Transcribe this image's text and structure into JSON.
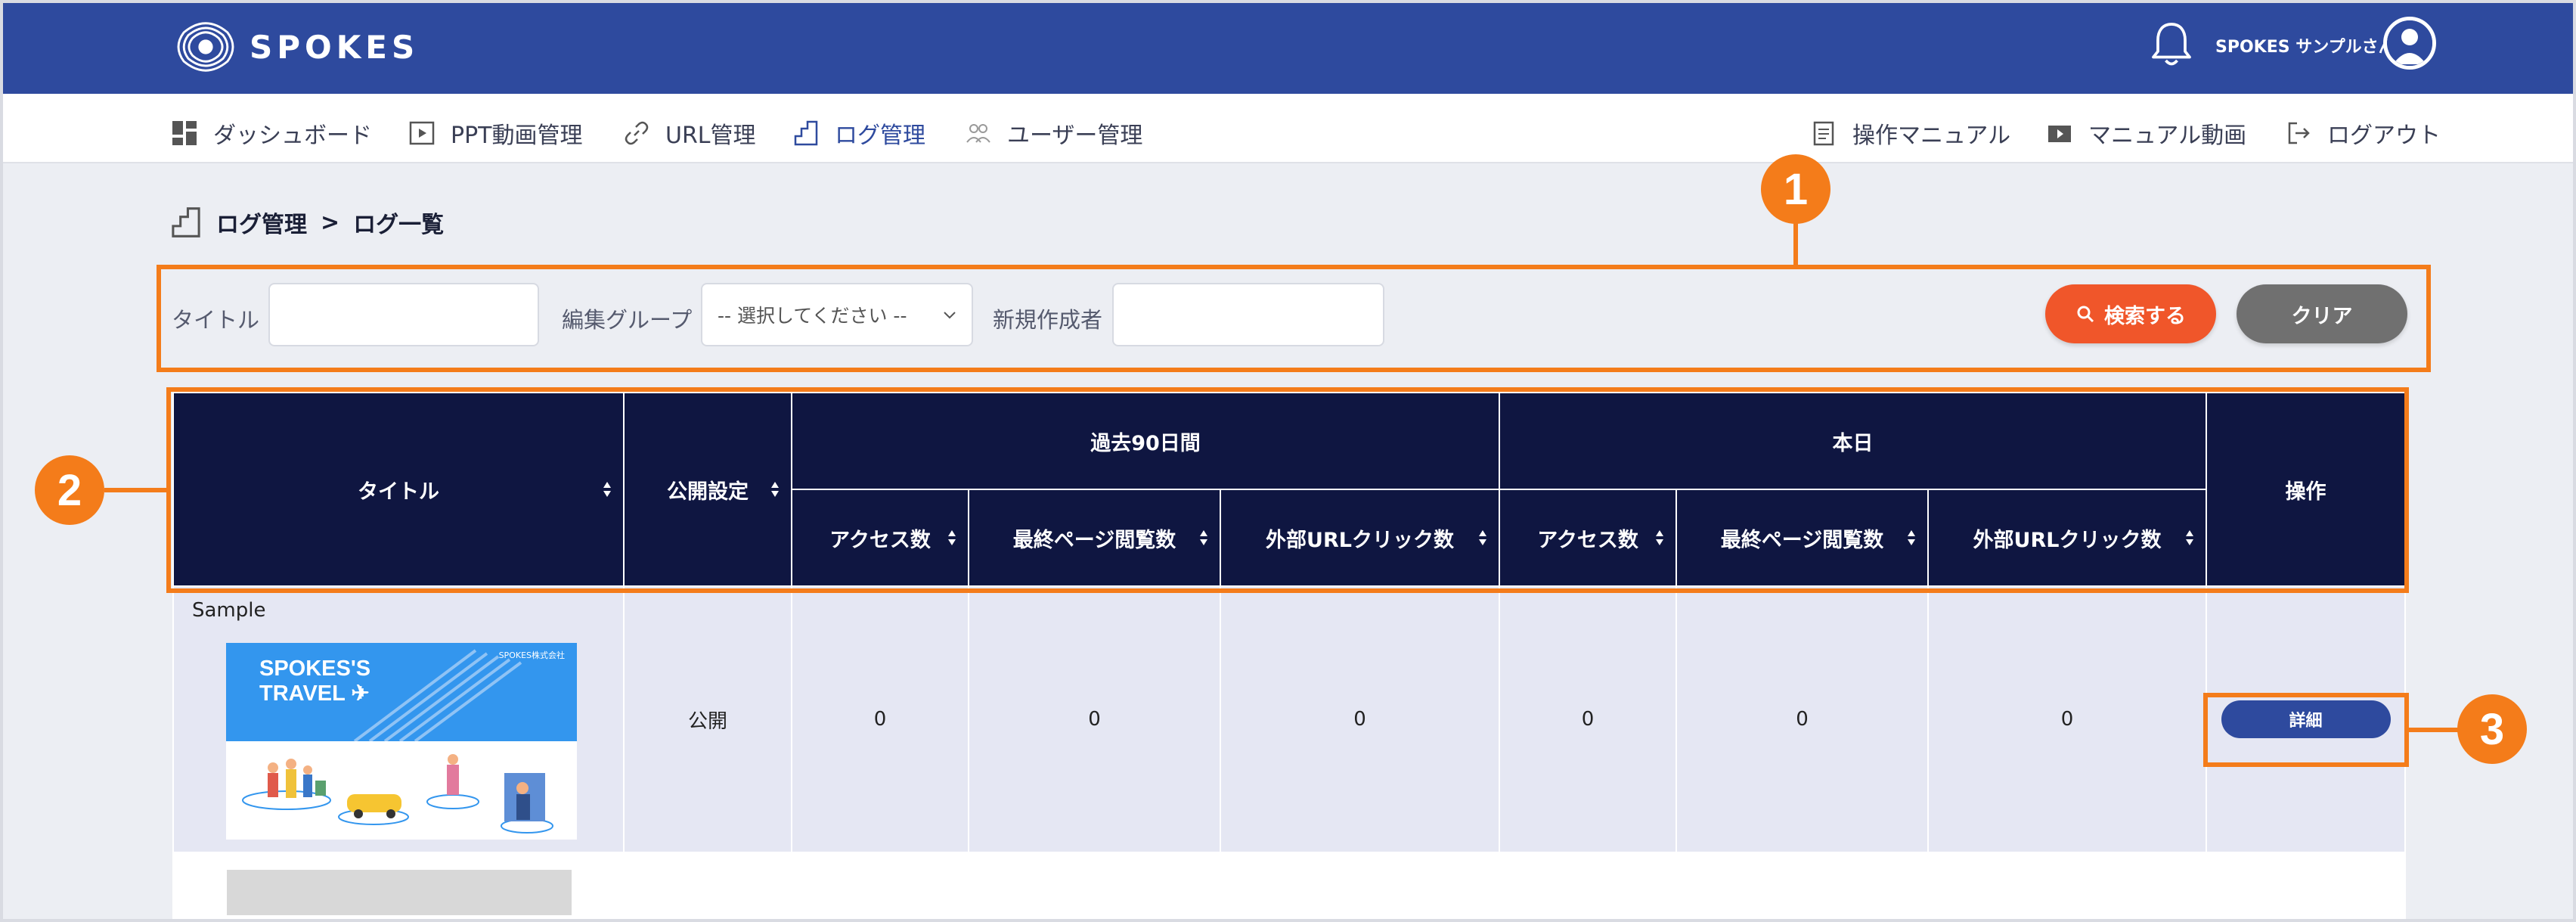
{
  "header": {
    "logo_text": "SPOKES",
    "user_name": "SPOKES サンプルさん"
  },
  "nav": {
    "left": [
      {
        "label": "ダッシュボード",
        "icon": "dashboard-icon"
      },
      {
        "label": "PPT動画管理",
        "icon": "ppt-video-icon"
      },
      {
        "label": "URL管理",
        "icon": "link-icon"
      },
      {
        "label": "ログ管理",
        "icon": "log-icon",
        "active": true
      },
      {
        "label": "ユーザー管理",
        "icon": "users-icon"
      }
    ],
    "right": [
      {
        "label": "操作マニュアル",
        "icon": "manual-icon"
      },
      {
        "label": "マニュアル動画",
        "icon": "video-icon"
      },
      {
        "label": "ログアウト",
        "icon": "logout-icon"
      }
    ]
  },
  "breadcrumb": {
    "parent": "ログ管理",
    "separator": ">",
    "current": "ログ一覧"
  },
  "search": {
    "title_label": "タイトル",
    "title_value": "",
    "group_label": "編集グループ",
    "group_selected": "-- 選択してください --",
    "creator_label": "新規作成者",
    "creator_value": "",
    "search_button": "検索する",
    "clear_button": "クリア"
  },
  "table": {
    "headers": {
      "title": "タイトル",
      "visibility": "公開設定",
      "past90": "過去90日間",
      "today": "本日",
      "actions": "操作",
      "access": "アクセス数",
      "last_page": "最終ページ閲覧数",
      "external_url": "外部URLクリック数"
    },
    "rows": [
      {
        "title": "Sample",
        "thumbnail": {
          "title_line1": "SPOKES'S",
          "title_line2": "TRAVEL",
          "company": "SPOKES株式会社"
        },
        "visibility": "公開",
        "past90_access": "0",
        "past90_last_page": "0",
        "past90_external": "0",
        "today_access": "0",
        "today_last_page": "0",
        "today_external": "0",
        "detail_button": "詳細"
      }
    ]
  },
  "annotations": {
    "badge1": "1",
    "badge2": "2",
    "badge3": "3"
  },
  "colors": {
    "header_bg": "#2e4a9e",
    "table_header_bg": "#0f1641",
    "accent_orange": "#f47c1a",
    "search_button": "#f0562a",
    "clear_button": "#707070"
  }
}
